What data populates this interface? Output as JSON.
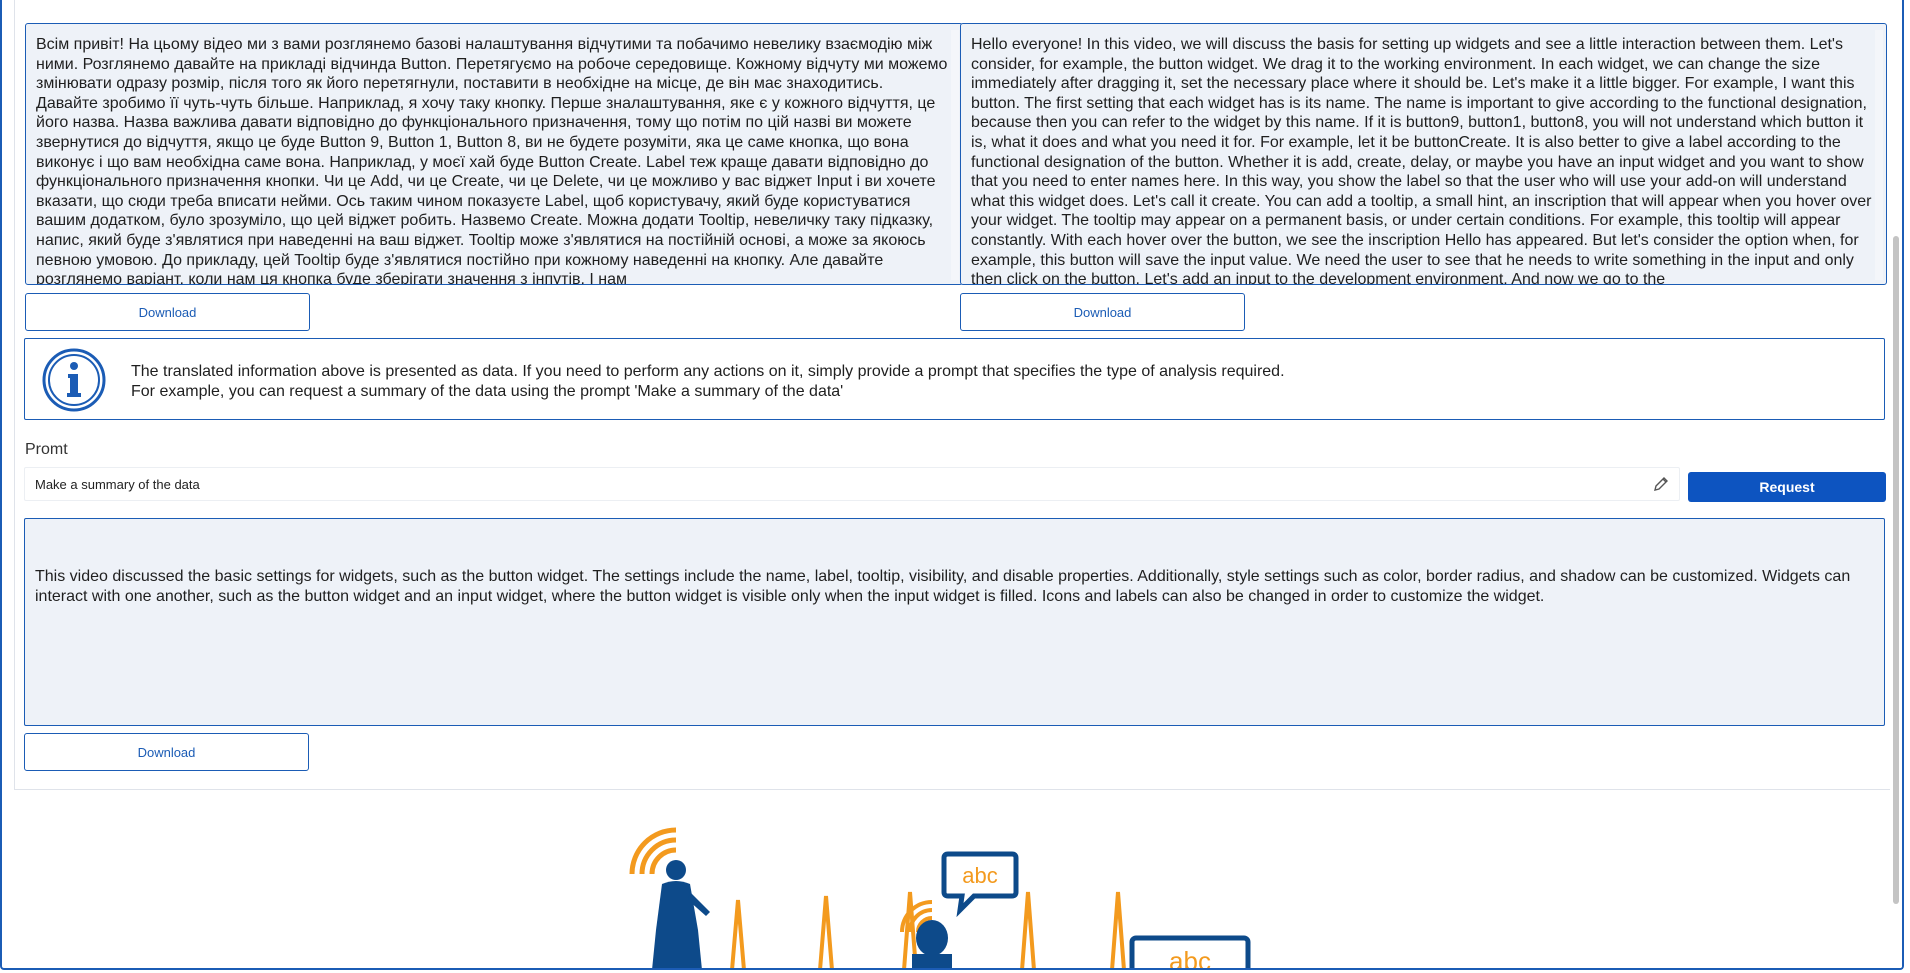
{
  "source_panel": {
    "text": "Всім привіт! На цьому відео ми з вами розглянемо базові налаштування відчутими та побачимо невелику взаємодію між ними. Розглянемо давайте на прикладі відчинда Button. Перетягуємо на робоче середовище. Кожному відчуту ми можемо змінювати одразу розмір, після того як його перетягнули, поставити в необхідне на місце, де він має знаходитись. Давайте зробимо її чуть-чуть більше. Наприклад, я хочу таку кнопку. Перше зналаштування, яке є у кожного відчуття, це його назва. Назва важлива давати відповідно до функціонального призначення, тому що потім по цій назві ви можете звернутися до відчуття, якщо це буде Button 9, Button 1, Button 8, ви не будете розуміти, яка це саме кнопка, що вона виконує і що вам необхідна саме вона. Наприклад, у моєї хай буде Button Create. Label теж краще давати відповідно до функціонального призначення кнопки. Чи це Add, чи це Create, чи це Delete, чи це можливо у вас віджет Input і ви хочете вказати, що сюди треба вписати нейми. Ось таким чином показуєте Label, щоб користувачу, який буде користуватися вашим додатком, було зрозуміло, що цей віджет робить. Назвемо Create. Можна додати Tooltip, невеличку таку підказку, напис, який буде з'являтися при наведенні на ваш віджет. Tooltip може з'являтися на постійній основі, а може за якоюсь певною умовою. До прикладу, цей Tooltip буде з'являтися постійно при кожному наведенні на кнопку. Але давайте розглянемо варіант, коли нам ця кнопка буде зберігати значення з інпутів. І нам",
    "download_label": "Download"
  },
  "translation_panel": {
    "text": "Hello everyone! In this video, we will discuss the basis for setting up widgets and see a little interaction between them. Let's consider, for example, the button widget. We drag it to the working environment. In each widget, we can change the size immediately after dragging it, set the necessary place where it should be. Let's make it a little bigger. For example, I want this button. The first setting that each widget has is its name. The name is important to give according to the functional designation, because then you can refer to the widget by this name. If it is button9, button1, button8, you will not understand which button it is, what it does and what you need it for. For example, let it be buttonCreate. It is also better to give a label according to the functional designation of the button. Whether it is add, create, delay, or maybe you have an input widget and you want to show that you need to enter names here. In this way, you show the label so that the user who will use your add-on will understand what this widget does. Let's call it create. You can add a tooltip, a small hint, an inscription that will appear when you hover over your widget. The tooltip may appear on a permanent basis, or under certain conditions. For example, this tooltip will appear constantly. With each hover over the button, we see the inscription Hello has appeared. But let's consider the option when, for example, this button will save the input value. We need the user to see that he needs to write something in the input and only then click on the button. Let's add an input to the development environment. And now we go to the",
    "download_label": "Download"
  },
  "info": {
    "icon": "info-icon",
    "line1": "The translated information above is presented as data. If you need to perform any actions on it, simply provide a prompt that specifies the type of analysis required.",
    "line2": "For example, you can request a summary of the data using the prompt 'Make a summary of the data'"
  },
  "prompt": {
    "label": "Promt",
    "value": "Make a summary of the data",
    "request_label": "Request"
  },
  "result": {
    "text": "This video discussed the basic settings for widgets, such as the button widget. The settings include the name, label, tooltip, visibility, and disable properties. Additionally, style settings such as color, border radius, and shadow can be customized. Widgets can interact with one another, such as the button widget and an input widget, where the button widget is visible only when the input widget is filled. Icons and labels can also be changed in order to customize the widget.",
    "download_label": "Download"
  },
  "illustration": {
    "bubble_text": "abc",
    "screen_text": "abc"
  },
  "colors": {
    "accent": "#1b5cb5",
    "button_fill": "#0d54c0",
    "box_fill": "#eef2f8",
    "illustration_navy": "#0d4a8a",
    "illustration_orange": "#f39a1e"
  }
}
